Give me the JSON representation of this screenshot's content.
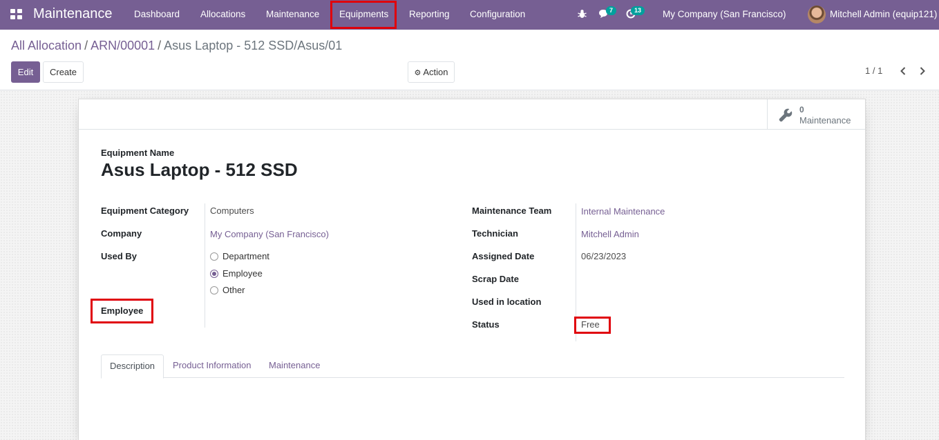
{
  "navbar": {
    "brand": "Maintenance",
    "menu": [
      "Dashboard",
      "Allocations",
      "Maintenance",
      "Equipments",
      "Reporting",
      "Configuration"
    ],
    "messages_count": "7",
    "activities_count": "13",
    "company": "My Company (San Francisco)",
    "user": "Mitchell Admin (equip121)"
  },
  "control_panel": {
    "breadcrumb": [
      "All Allocation",
      "ARN/00001",
      "Asus Laptop - 512 SSD/Asus/01"
    ],
    "edit_label": "Edit",
    "create_label": "Create",
    "action_label": "Action",
    "pager": "1 / 1"
  },
  "stat_button": {
    "value": "0",
    "label": "Maintenance"
  },
  "form": {
    "name_label": "Equipment Name",
    "name": "Asus Laptop - 512 SSD",
    "left": {
      "category_label": "Equipment Category",
      "category": "Computers",
      "company_label": "Company",
      "company": "My Company (San Francisco)",
      "used_by_label": "Used By",
      "used_by_options": [
        "Department",
        "Employee",
        "Other"
      ],
      "used_by_selected": "Employee",
      "employee_label": "Employee"
    },
    "right": {
      "team_label": "Maintenance Team",
      "team": "Internal Maintenance",
      "technician_label": "Technician",
      "technician": "Mitchell Admin",
      "assigned_label": "Assigned Date",
      "assigned": "06/23/2023",
      "scrap_label": "Scrap Date",
      "location_label": "Used in location",
      "status_label": "Status",
      "status": "Free"
    }
  },
  "tabs": [
    "Description",
    "Product Information",
    "Maintenance"
  ],
  "colors": {
    "brand": "#765f93",
    "highlight": "#e0000b",
    "badge": "#00a09d"
  }
}
